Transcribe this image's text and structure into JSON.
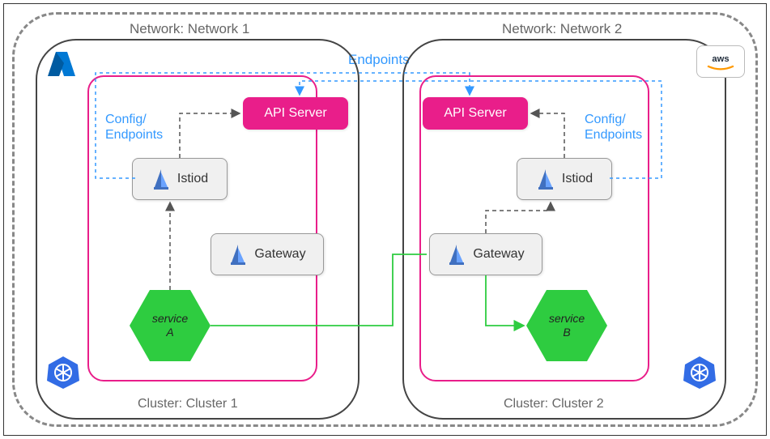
{
  "labels": {
    "network1": "Network: Network 1",
    "network2": "Network: Network 2",
    "endpoints": "Endpoints",
    "config_endpoints": "Config/\nEndpoints",
    "cluster1": "Cluster: Cluster 1",
    "cluster2": "Cluster: Cluster 2",
    "api_server": "API Server",
    "istiod": "Istiod",
    "gateway": "Gateway",
    "service_a": "service\nA",
    "service_b": "service\nB"
  },
  "icons": {
    "azure": "azure",
    "aws": "aws",
    "kubernetes": "kubernetes",
    "istio": "istio-sail"
  },
  "chart_data": {
    "type": "diagram",
    "title": "Istio Multi-Cluster Mesh across Network 1 (Azure) and Network 2 (AWS)",
    "networks": [
      {
        "name": "Network 1",
        "cloud": "Azure",
        "cluster": "Cluster 1",
        "components": [
          "API Server",
          "Istiod",
          "Gateway",
          "service A"
        ]
      },
      {
        "name": "Network 2",
        "cloud": "AWS",
        "cluster": "Cluster 2",
        "components": [
          "API Server",
          "Istiod",
          "Gateway",
          "service B"
        ]
      }
    ],
    "connections": [
      {
        "from": "Istiod (Cluster 1)",
        "to": "API Server (Cluster 1)",
        "label": "Config/Endpoints",
        "style": "dashed"
      },
      {
        "from": "Istiod (Cluster 2)",
        "to": "API Server (Cluster 2)",
        "label": "Config/Endpoints",
        "style": "dashed"
      },
      {
        "from": "Istiod (Cluster 1)",
        "to": "API Server (Cluster 2)",
        "label": "Endpoints",
        "style": "dashed-blue"
      },
      {
        "from": "Istiod (Cluster 2)",
        "to": "API Server (Cluster 1)",
        "label": "Endpoints",
        "style": "dashed-blue"
      },
      {
        "from": "service A",
        "to": "Istiod (Cluster 1)",
        "style": "dashed"
      },
      {
        "from": "Gateway (Cluster 2)",
        "to": "Istiod (Cluster 2)",
        "style": "dashed"
      },
      {
        "from": "service A",
        "to": "Gateway (Cluster 2)",
        "to2": "service B",
        "style": "solid-green"
      }
    ]
  }
}
